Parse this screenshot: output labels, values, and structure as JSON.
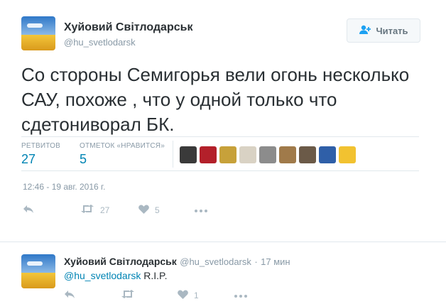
{
  "tweet": {
    "author_name": "Хуйовий Світлодарськ",
    "author_handle": "@hu_svetlodarsk",
    "follow_label": "Читать",
    "text": "Со стороны Семигорья вели огонь несколько САУ, похоже , что у одной только что сдетониворал БК.",
    "retweets_label": "РЕТВИТОВ",
    "retweets_count": "27",
    "likes_label": "ОТМЕТОК «НРАВИТСЯ»",
    "likes_count": "5",
    "timestamp": "12:46 - 19 авг. 2016 г.",
    "action_retweet_count": "27",
    "action_like_count": "5",
    "liker_colors": [
      "#3a3a3a",
      "#b3202a",
      "#c7a13a",
      "#d9d2c4",
      "#8c8c8c",
      "#a07a4a",
      "#6b5a48",
      "#2f5fa8",
      "#f2c230"
    ]
  },
  "reply": {
    "author_name": "Хуйовий Світлодарськ",
    "author_handle": "@hu_svetlodarsk",
    "time": "17 мин",
    "mention": "@hu_svetlodarsk",
    "text": "R.I.P.",
    "like_count": "1"
  },
  "colors": {
    "accent": "#0084b4",
    "muted": "#8899a6",
    "border": "#e1e8ed"
  }
}
